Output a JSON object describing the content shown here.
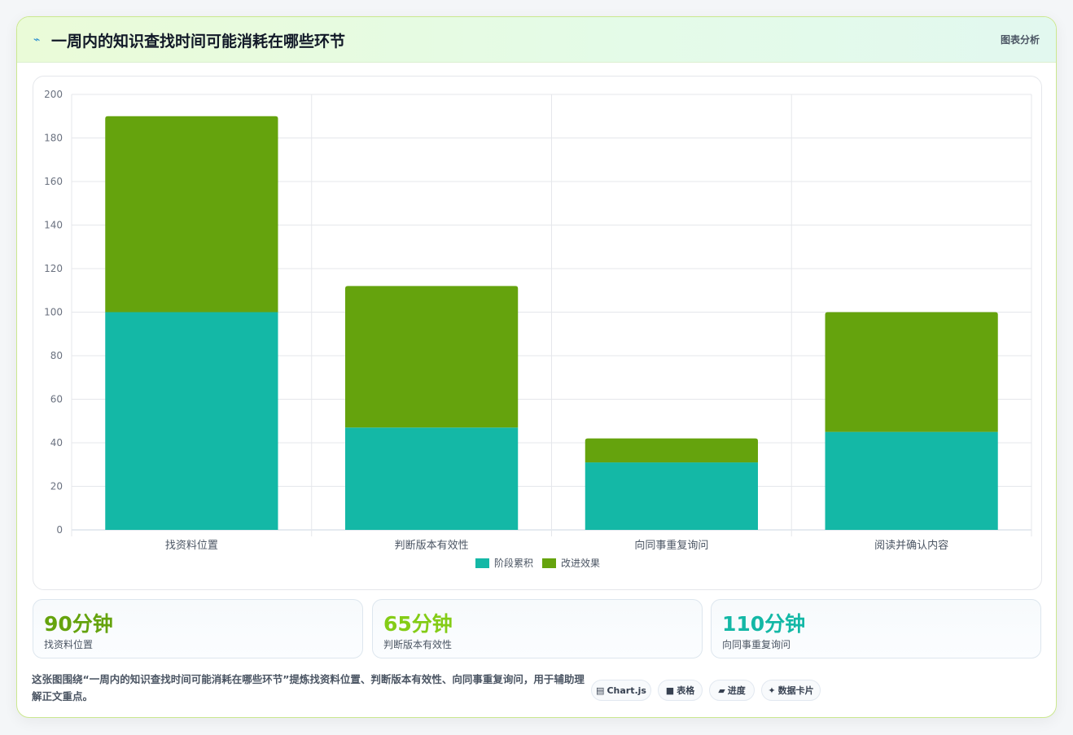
{
  "header": {
    "icon": "lightning-icon",
    "title": "一周内的知识查找时间可能消耗在哪些环节",
    "link_label": "图表分析"
  },
  "chart_data": {
    "type": "bar",
    "stacked": true,
    "categories": [
      "找资料位置",
      "判断版本有效性",
      "向同事重复询问",
      "阅读并确认内容"
    ],
    "series": [
      {
        "name": "阶段累积",
        "color": "#14b8a6",
        "values": [
          100,
          47,
          31,
          45
        ]
      },
      {
        "name": "改进效果",
        "color": "#65a30d",
        "values": [
          90,
          65,
          11,
          55
        ]
      }
    ],
    "ylim": [
      0,
      200
    ],
    "yticks": [
      0,
      20,
      40,
      60,
      80,
      100,
      120,
      140,
      160,
      180,
      200
    ],
    "grid": true,
    "legend_position": "bottom"
  },
  "kpis": [
    {
      "value": "90分钟",
      "label": "找资料位置",
      "color": "#65a30d"
    },
    {
      "value": "65分钟",
      "label": "判断版本有效性",
      "color": "#84cc16"
    },
    {
      "value": "110分钟",
      "label": "向同事重复询问",
      "color": "#14b8a6"
    }
  ],
  "footer": {
    "text": "这张图围绕“一周内的知识查找时间可能消耗在哪些环节”提炼找资料位置、判断版本有效性、向同事重复询问，用于辅助理解正文重点。",
    "chips": [
      {
        "icon": "chart-icon",
        "glyph": "▤",
        "label": "Chart.js"
      },
      {
        "icon": "table-icon",
        "glyph": "■",
        "label": "表格"
      },
      {
        "icon": "progress-icon",
        "glyph": "▰",
        "label": "进度"
      },
      {
        "icon": "sparkle-icon",
        "glyph": "✦",
        "label": "数据卡片"
      }
    ]
  }
}
